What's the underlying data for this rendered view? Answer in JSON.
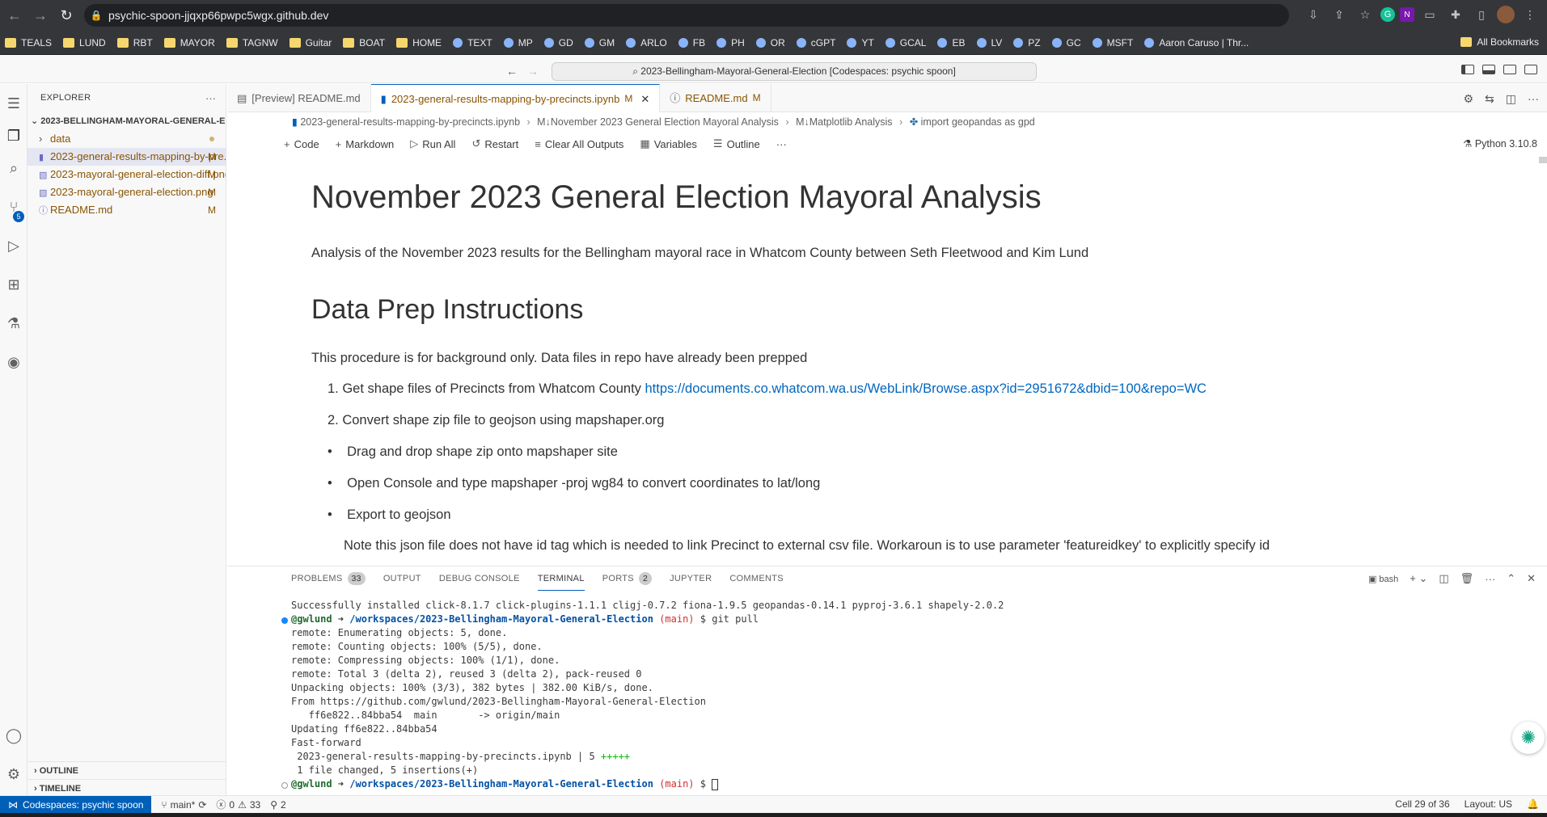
{
  "browser": {
    "url": "psychic-spoon-jjqxp66pwpc5wgx.github.dev",
    "bookmarks": [
      {
        "label": "TEALS",
        "icon": "folder-icon"
      },
      {
        "label": "LUND",
        "icon": "folder-icon"
      },
      {
        "label": "RBT",
        "icon": "folder-icon"
      },
      {
        "label": "MAYOR",
        "icon": "folder-icon"
      },
      {
        "label": "TAGNW",
        "icon": "folder-icon"
      },
      {
        "label": "Guitar",
        "icon": "folder-icon"
      },
      {
        "label": "BOAT",
        "icon": "folder-icon"
      },
      {
        "label": "HOME",
        "icon": "folder-icon"
      },
      {
        "label": "TEXT",
        "icon": "chat-icon"
      },
      {
        "label": "MP",
        "icon": "maps-icon"
      },
      {
        "label": "GD",
        "icon": "drive-icon"
      },
      {
        "label": "GM",
        "icon": "gmail-icon"
      },
      {
        "label": "ARLO",
        "icon": "arlo-icon"
      },
      {
        "label": "FB",
        "icon": "facebook-icon"
      },
      {
        "label": "PH",
        "icon": "photos-icon"
      },
      {
        "label": "OR",
        "icon": "or-icon"
      },
      {
        "label": "cGPT",
        "icon": "chatgpt-icon"
      },
      {
        "label": "YT",
        "icon": "youtube-icon"
      },
      {
        "label": "GCAL",
        "icon": "calendar-icon"
      },
      {
        "label": "EB",
        "icon": "eb-icon"
      },
      {
        "label": "LV",
        "icon": "lv-icon"
      },
      {
        "label": "PZ",
        "icon": "pz-icon"
      },
      {
        "label": "GC",
        "icon": "gc-icon"
      },
      {
        "label": "MSFT",
        "icon": "microsoft-icon"
      },
      {
        "label": "Aaron Caruso | Thr...",
        "icon": "teams-icon"
      }
    ],
    "all_bookmarks": "All Bookmarks"
  },
  "vscode": {
    "command_center": "2023-Bellingham-Mayoral-General-Election [Codespaces: psychic spoon]",
    "explorer": {
      "title": "EXPLORER",
      "root": "2023-BELLINGHAM-MAYORAL-GENERAL-ELECTION...",
      "items": [
        {
          "label": "data",
          "type": "folder",
          "status": ""
        },
        {
          "label": "2023-general-results-mapping-by-pre...",
          "type": "notebook",
          "status": "M"
        },
        {
          "label": "2023-mayoral-general-election-diff.png",
          "type": "image",
          "status": "M"
        },
        {
          "label": "2023-mayoral-general-election.png",
          "type": "image",
          "status": "M"
        },
        {
          "label": "README.md",
          "type": "info",
          "status": "M"
        }
      ],
      "outline": "OUTLINE",
      "timeline": "TIMELINE"
    },
    "scm_badge": "5",
    "tabs": [
      {
        "label": "[Preview] README.md",
        "status": ""
      },
      {
        "label": "2023-general-results-mapping-by-precincts.ipynb",
        "status": "M"
      },
      {
        "label": "README.md",
        "status": "M"
      }
    ],
    "breadcrumb": [
      "2023-general-results-mapping-by-precincts.ipynb",
      "M↓November 2023 General Election Mayoral Analysis",
      "M↓Matplotlib Analysis",
      "import geopandas as gpd"
    ],
    "toolbar": {
      "code": "Code",
      "markdown": "Markdown",
      "run_all": "Run All",
      "restart": "Restart",
      "clear_outputs": "Clear All Outputs",
      "variables": "Variables",
      "outline": "Outline",
      "more": "···",
      "kernel": "Python 3.10.8"
    },
    "notebook": {
      "h1": "November 2023 General Election Mayoral Analysis",
      "intro": "Analysis of the November 2023 results for the Bellingham mayoral race in Whatcom County between Seth Fleetwood and Kim Lund",
      "h2": "Data Prep Instructions",
      "note1": "This procedure is for background only. Data files in repo have already been prepped",
      "step1_text": "1. Get shape files of Precincts from Whatcom County ",
      "step1_link": "https://documents.co.whatcom.wa.us/WebLink/Browse.aspx?id=2951672&dbid=100&repo=WC",
      "step2": "2. Convert shape zip file to geojson using mapshaper.org",
      "bullet1": "Drag and drop shape zip onto mapshaper site",
      "bullet2": "Open Console and type mapshaper -proj wg84 to convert coordinates to lat/long",
      "bullet3": "Export to geojson",
      "note2": "Note this json file does not have id tag which is needed to link Precinct to external csv file. Workaroun is to use parameter 'featureidkey' to explicitly specify id"
    },
    "panel": {
      "tabs": [
        {
          "label": "PROBLEMS",
          "badge": "33"
        },
        {
          "label": "OUTPUT",
          "badge": ""
        },
        {
          "label": "DEBUG CONSOLE",
          "badge": ""
        },
        {
          "label": "TERMINAL",
          "badge": ""
        },
        {
          "label": "PORTS",
          "badge": "2"
        },
        {
          "label": "JUPYTER",
          "badge": ""
        },
        {
          "label": "COMMENTS",
          "badge": ""
        }
      ],
      "shell": "bash",
      "terminal": {
        "line0": "Successfully installed click-8.1.7 click-plugins-1.1.1 cligj-0.7.2 fiona-1.9.5 geopandas-0.14.1 pyproj-3.6.1 shapely-2.0.2",
        "prompt_user": "@gwlund",
        "prompt_arrow": " ➜ ",
        "prompt_path": "/workspaces/2023-Bellingham-Mayoral-General-Election",
        "prompt_branch": "(main)",
        "prompt_cmd": " $ git pull",
        "prompt_end": " $ ",
        "lines": [
          "remote: Enumerating objects: 5, done.",
          "remote: Counting objects: 100% (5/5), done.",
          "remote: Compressing objects: 100% (1/1), done.",
          "remote: Total 3 (delta 2), reused 3 (delta 2), pack-reused 0",
          "Unpacking objects: 100% (3/3), 382 bytes | 382.00 KiB/s, done.",
          "From https://github.com/gwlund/2023-Bellingham-Mayoral-General-Election",
          "   ff6e822..84bba54  main       -> origin/main",
          "Updating ff6e822..84bba54",
          "Fast-forward"
        ],
        "diffstat_file": " 2023-general-results-mapping-by-precincts.ipynb | 5 ",
        "diffstat_plus": "+++++",
        "summary": " 1 file changed, 5 insertions(+)"
      }
    },
    "status": {
      "remote": "Codespaces: psychic spoon",
      "branch": "main*",
      "errors": "0",
      "warnings": "33",
      "ports": "2",
      "cell": "Cell 29 of 36",
      "layout": "Layout: US"
    }
  }
}
